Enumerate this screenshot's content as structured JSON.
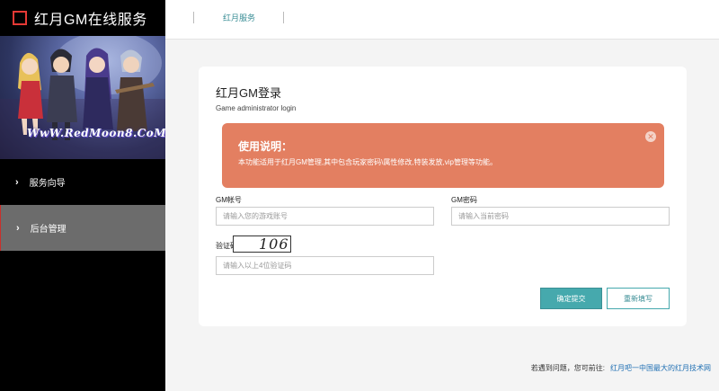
{
  "app": {
    "title": "红月GM在线服务",
    "banner_text": "WwW.RedMoon8.CoM"
  },
  "sidebar": {
    "items": [
      {
        "label": "服务向导",
        "active": false
      },
      {
        "label": "后台管理",
        "active": true
      }
    ]
  },
  "topbar": {
    "tab_label": "红月服务"
  },
  "login": {
    "title": "红月GM登录",
    "subtitle": "Game administrator login",
    "alert": {
      "title": "使用说明：",
      "body": "本功能适用于红月GM管理,其中包含玩家密码\\属性修改,特装发放,vip管理等功能。",
      "close_icon": "close-icon"
    },
    "account": {
      "label": "GM帐号",
      "placeholder": "请输入您的游戏账号",
      "value": ""
    },
    "password": {
      "label": "GM密码",
      "placeholder": "请输入当前密码",
      "value": ""
    },
    "captcha": {
      "label": "验证码：",
      "image_text": "1067",
      "placeholder": "请输入以上4位验证码",
      "value": ""
    },
    "submit_label": "确定提交",
    "reset_label": "重新填写"
  },
  "footer": {
    "text": "若遇到问题，您可前往:",
    "link_text": "红月吧一中国最大的红月技术网"
  },
  "colors": {
    "sidebar_bg": "#000000",
    "active_item_bg": "#6c6c6c",
    "accent_teal": "#46a9ad",
    "alert_bg": "#e37f61",
    "brand_red": "#e53935"
  }
}
